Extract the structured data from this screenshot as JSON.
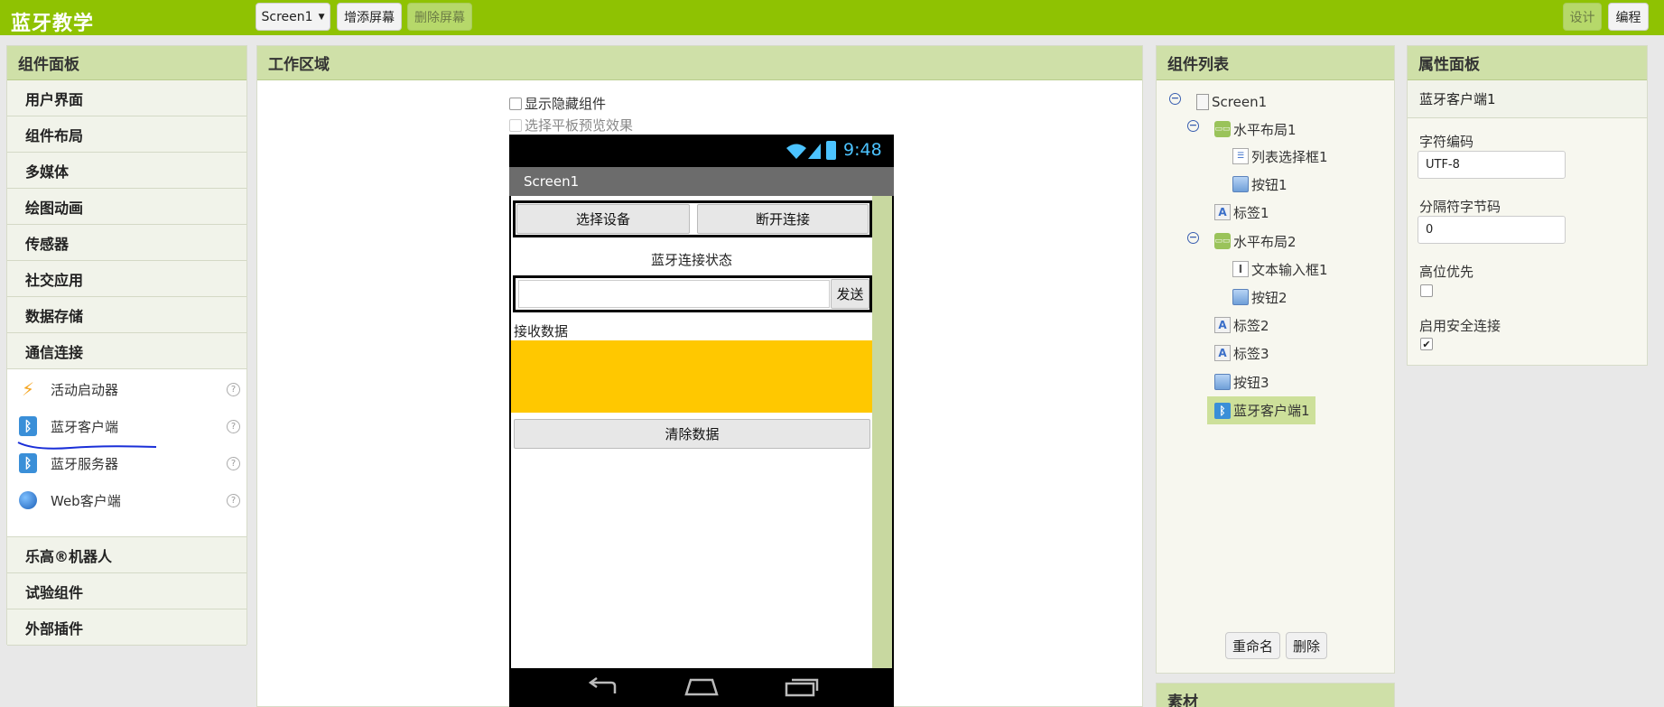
{
  "app": {
    "title": "蓝牙教学"
  },
  "toolbar": {
    "screen_select": "Screen1",
    "add_screen": "增添屏幕",
    "remove_screen": "删除屏幕",
    "design": "设计",
    "blocks": "编程"
  },
  "palette": {
    "title": "组件面板",
    "categories_top": [
      "用户界面",
      "组件布局",
      "多媒体",
      "绘图动画",
      "传感器",
      "社交应用",
      "数据存储",
      "通信连接"
    ],
    "connectivity_items": [
      {
        "label": "活动启动器",
        "icon": "activity-starter-icon"
      },
      {
        "label": "蓝牙客户端",
        "icon": "bluetooth-icon"
      },
      {
        "label": "蓝牙服务器",
        "icon": "bluetooth-icon"
      },
      {
        "label": "Web客户端",
        "icon": "globe-icon"
      }
    ],
    "help_glyph": "?",
    "categories_bottom": [
      "乐高®机器人",
      "试验组件",
      "外部插件"
    ]
  },
  "workarea": {
    "title": "工作区域",
    "show_hidden": "显示隐藏组件",
    "tablet_preview": "选择平板预览效果",
    "phone": {
      "time": "9:48",
      "screen_title": "Screen1",
      "btn_select_device": "选择设备",
      "btn_disconnect": "断开连接",
      "status_label": "蓝牙连接状态",
      "send_button": "发送",
      "receive_label": "接收数据",
      "clear_button": "清除数据"
    }
  },
  "components": {
    "title": "组件列表",
    "tree": [
      {
        "label": "Screen1",
        "icon": "screen-icon"
      },
      {
        "label": "水平布局1",
        "icon": "layout-icon"
      },
      {
        "label": "列表选择框1",
        "icon": "listpicker-icon"
      },
      {
        "label": "按钮1",
        "icon": "button-icon"
      },
      {
        "label": "标签1",
        "icon": "label-icon"
      },
      {
        "label": "水平布局2",
        "icon": "layout-icon"
      },
      {
        "label": "文本输入框1",
        "icon": "textbox-icon"
      },
      {
        "label": "按钮2",
        "icon": "button-icon"
      },
      {
        "label": "标签2",
        "icon": "label-icon"
      },
      {
        "label": "标签3",
        "icon": "label-icon"
      },
      {
        "label": "按钮3",
        "icon": "button-icon"
      },
      {
        "label": "蓝牙客户端1",
        "icon": "bluetooth-icon"
      }
    ],
    "rename": "重命名",
    "delete": "删除"
  },
  "media": {
    "title": "素材"
  },
  "properties": {
    "title": "属性面板",
    "component_name": "蓝牙客户端1",
    "charset_label": "字符编码",
    "charset_value": "UTF-8",
    "delimiter_label": "分隔符字节码",
    "delimiter_value": "0",
    "highbyte_label": "高位优先",
    "highbyte_checked": false,
    "secure_label": "启用安全连接",
    "secure_checked": true,
    "check_glyph": "✔"
  },
  "colors": {
    "topbar": "#8fc202",
    "panel_header": "#cfe0a8",
    "selected": "#cde09a",
    "yellow_canvas": "#ffc800"
  }
}
